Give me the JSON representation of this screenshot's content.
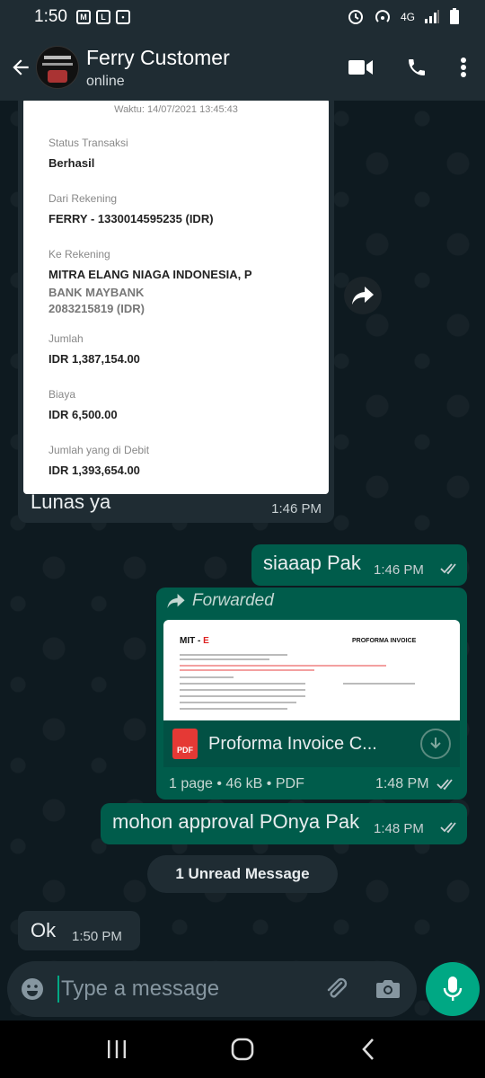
{
  "status_bar": {
    "time": "1:50",
    "network": "4G"
  },
  "header": {
    "name": "Ferry Customer",
    "status": "online"
  },
  "receipt": {
    "waktu": "Waktu: 14/07/2021 13:45:43",
    "status_label": "Status Transaksi",
    "status_value": "Berhasil",
    "dari_label": "Dari Rekening",
    "dari_value": "FERRY - 1330014595235 (IDR)",
    "ke_label": "Ke Rekening",
    "ke_value": "MITRA ELANG NIAGA INDONESIA, P",
    "ke_bank": "BANK MAYBANK",
    "ke_account": "2083215819 (IDR)",
    "jumlah_label": "Jumlah",
    "jumlah_value": "IDR 1,387,154.00",
    "biaya_label": "Biaya",
    "biaya_value": "IDR 6,500.00",
    "debit_label": "Jumlah yang di Debit",
    "debit_value": "IDR 1,393,654.00"
  },
  "messages": [
    {
      "text": "Lunas ya",
      "time": "1:46 PM"
    },
    {
      "text": "siaaap Pak",
      "time": "1:46 PM"
    },
    {
      "text": "mohon approval POnya Pak",
      "time": "1:48 PM"
    },
    {
      "text": "Ok",
      "time": "1:50 PM"
    }
  ],
  "document": {
    "forwarded_label": "Forwarded",
    "name": "Proforma Invoice C...",
    "meta": "1 page • 46 kB • PDF",
    "time": "1:48 PM",
    "pdf_badge": "PDF",
    "preview_logo_prefix": "MIT - ",
    "preview_logo_suffix": "E",
    "preview_title": "PROFORMA INVOICE"
  },
  "unread": "1 Unread Message",
  "input": {
    "placeholder": "Type a message"
  },
  "colors": {
    "accent": "#00a884",
    "outgoing": "#005c4b",
    "incoming": "#1f2c33"
  }
}
